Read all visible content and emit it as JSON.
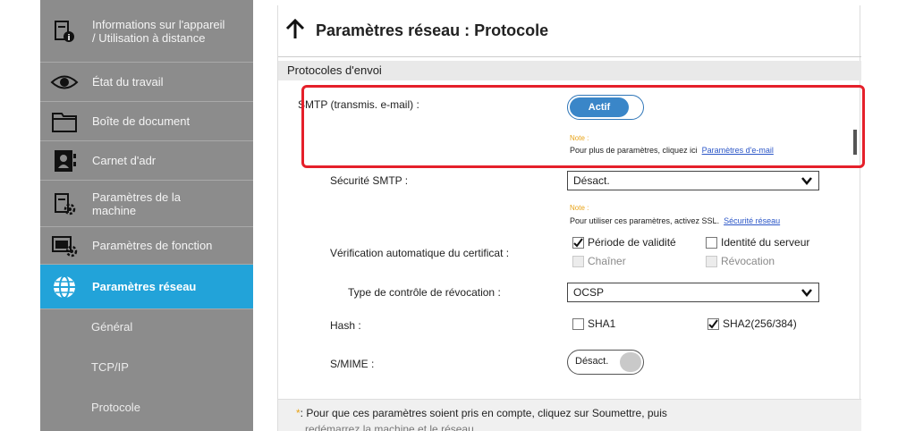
{
  "sidebar": {
    "items": [
      {
        "label": "Informations sur l'appareil / Utilisation à distance",
        "icon": "device-info-icon"
      },
      {
        "label": "État du travail",
        "icon": "eye-icon"
      },
      {
        "label": "Boîte de document",
        "icon": "folder-icon"
      },
      {
        "label": "Carnet d'adr",
        "icon": "address-book-icon"
      },
      {
        "label": "Paramètres de la machine",
        "icon": "machine-settings-icon"
      },
      {
        "label": "Paramètres de fonction",
        "icon": "function-settings-icon"
      },
      {
        "label": "Paramètres réseau",
        "icon": "globe-icon"
      }
    ],
    "submenu": [
      "Général",
      "TCP/IP",
      "Protocole"
    ]
  },
  "header": {
    "title": "Paramètres réseau : Protocole"
  },
  "section": {
    "title": "Protocoles d'envoi"
  },
  "smtp": {
    "label": "SMTP (transmis. e-mail) :",
    "toggle": "Actif",
    "note_label": "Note :",
    "note_text": "Pour plus de paramètres, cliquez ici",
    "note_link": "Paramètres d'e-mail"
  },
  "smtp_security": {
    "label": "Sécurité SMTP :",
    "value": "Désact.",
    "note_label": "Note :",
    "note_text": "Pour utiliser ces paramètres, activez SSL.",
    "note_link": "Sécurité réseau"
  },
  "cert_check": {
    "label": "Vérification automatique du certificat :",
    "options": [
      {
        "label": "Période de validité",
        "checked": true,
        "enabled": true
      },
      {
        "label": "Identité du serveur",
        "checked": false,
        "enabled": true
      },
      {
        "label": "Chaîner",
        "checked": false,
        "enabled": false
      },
      {
        "label": "Révocation",
        "checked": false,
        "enabled": false
      }
    ]
  },
  "revocation": {
    "label": "Type de contrôle de révocation :",
    "value": "OCSP"
  },
  "hash": {
    "label": "Hash :",
    "options": [
      {
        "label": "SHA1",
        "checked": false
      },
      {
        "label": "SHA2(256/384)",
        "checked": true
      }
    ]
  },
  "smime": {
    "label": "S/MIME :",
    "toggle": "Désact."
  },
  "footer": {
    "star": "*",
    "text": ": Pour que ces paramètres soient pris en compte, cliquez sur Soumettre, puis",
    "text2": "redémarrez la machine et le réseau."
  },
  "colors": {
    "accent": "#22a3d9",
    "highlight": "#e5202a",
    "toggle_on": "#3a86c8",
    "note": "#e8a317"
  }
}
